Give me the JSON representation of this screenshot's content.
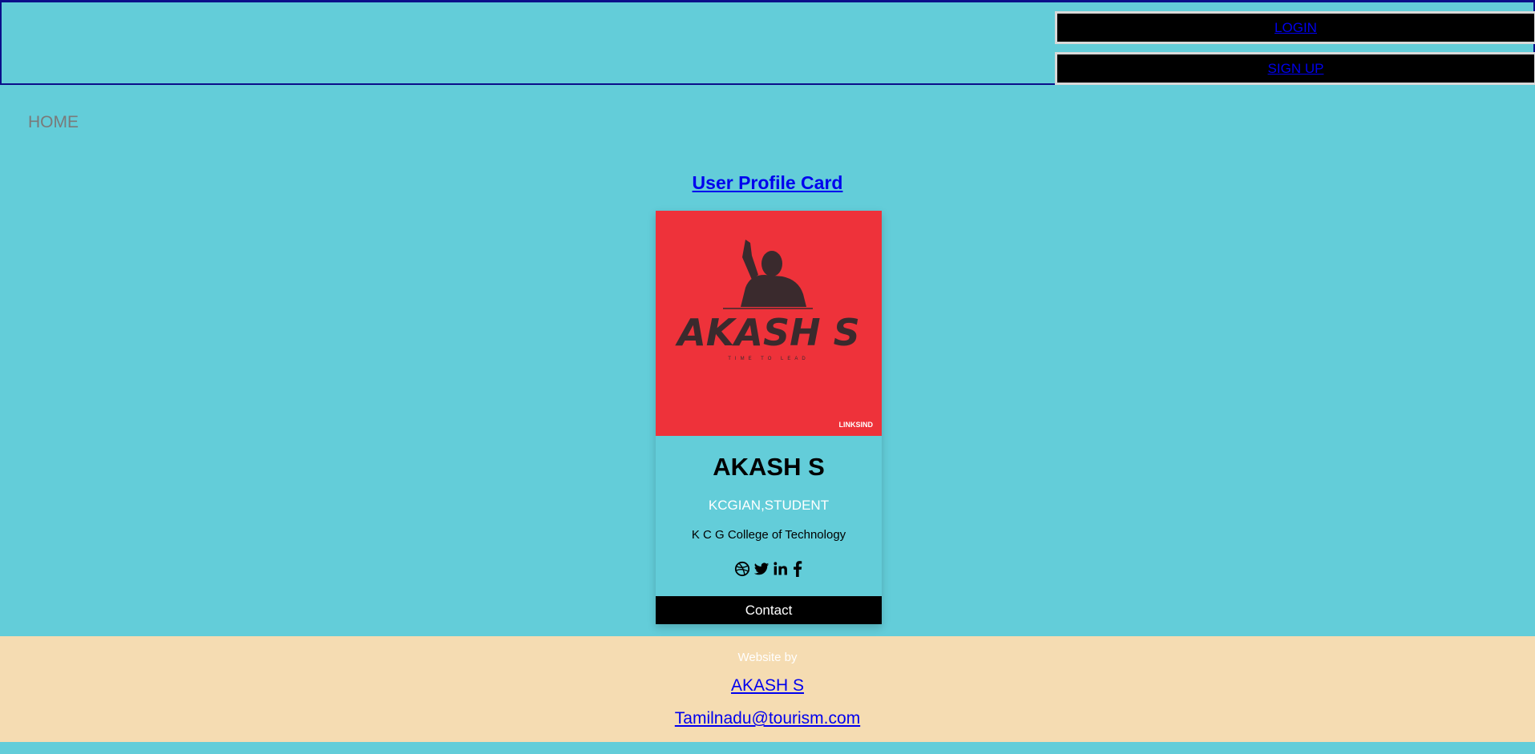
{
  "header": {
    "login_label": "LOGIN",
    "signup_label": "SIGN UP"
  },
  "nav": {
    "home_label": "HOME"
  },
  "main": {
    "title": "User Profile Card"
  },
  "card": {
    "image": {
      "logo_text": "AKASH S",
      "tagline": "TIME TO LEAD",
      "watermark": "LINKSIND"
    },
    "name": "AKASH S",
    "role": "KCGIAN,STUDENT",
    "college": "K C G College of Technology",
    "social_icons": [
      "dribbble-icon",
      "twitter-icon",
      "linkedin-icon",
      "facebook-icon"
    ],
    "contact_label": "Contact"
  },
  "footer": {
    "by_label": "Website by",
    "author": "AKASH S",
    "email": "Tamilnadu@tourism.com"
  },
  "colors": {
    "background": "#63cdd9",
    "card_image_bg": "#ee323a",
    "footer_bg": "#f5dcb2",
    "link": "#0000ee"
  }
}
